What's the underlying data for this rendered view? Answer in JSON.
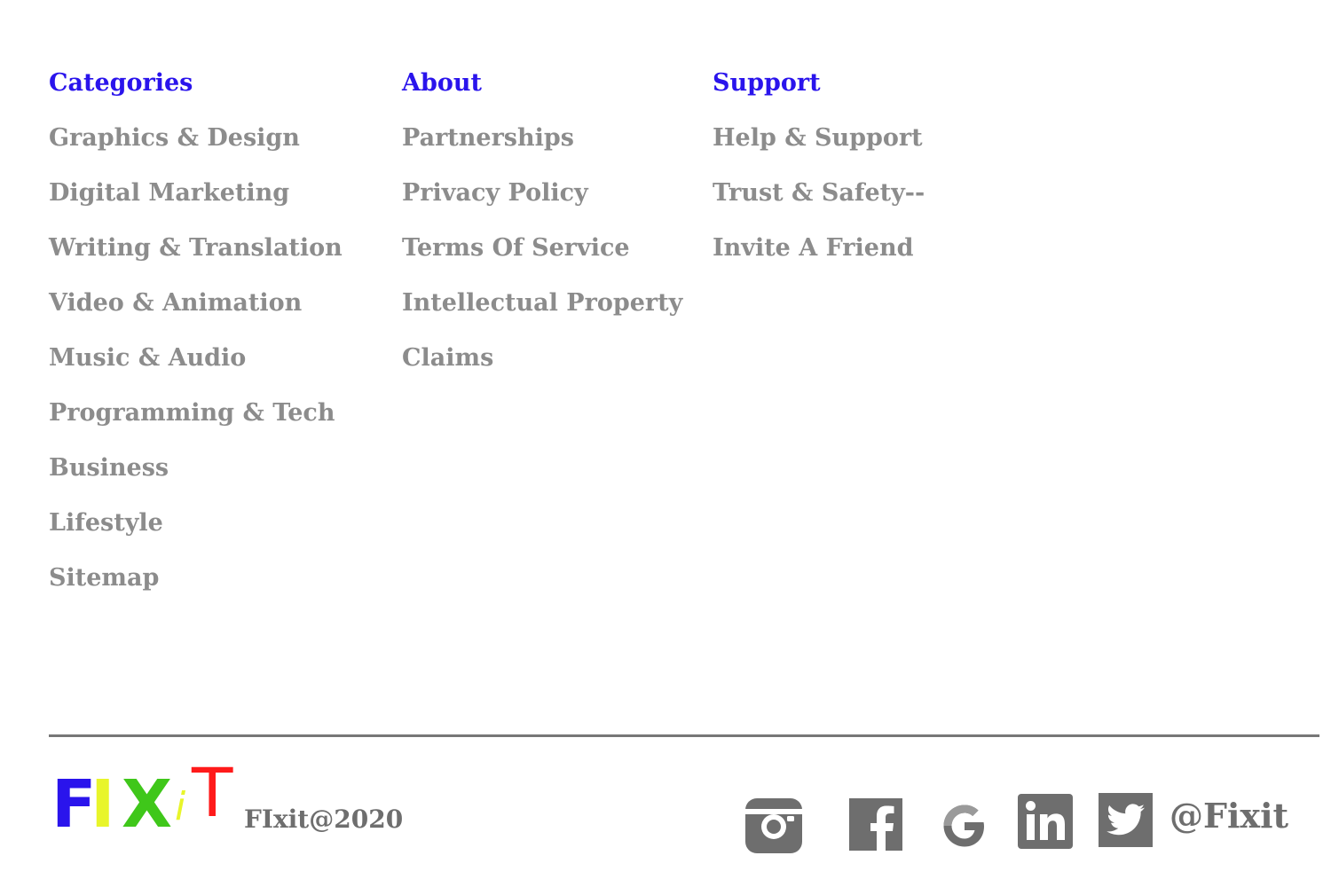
{
  "columns": {
    "categories": {
      "heading": "Categories",
      "items": [
        "Graphics & Design",
        "Digital Marketing",
        "Writing & Translation",
        "Video & Animation",
        "Music & Audio",
        "Programming & Tech",
        "Business",
        "Lifestyle",
        "Sitemap"
      ]
    },
    "about": {
      "heading": "About",
      "items": [
        "Partnerships",
        "Privacy Policy",
        "Terms Of Service",
        "Intellectual Property",
        "Claims"
      ]
    },
    "support": {
      "heading": "Support",
      "items": [
        "Help & Support",
        "Trust & Safety--",
        "Invite A Friend"
      ]
    }
  },
  "bottom_bar": {
    "logo": {
      "letters": [
        {
          "char": "F",
          "color": "#2a14ec"
        },
        {
          "char": "I",
          "color": "#e8f52a"
        },
        {
          "char": "X",
          "color": "#3fc71a"
        },
        {
          "char": "i",
          "color": "#e8f52a"
        },
        {
          "char": "T",
          "color": "#ff1a1a"
        }
      ]
    },
    "copyright": "FIxit@2020",
    "social_icons": [
      "instagram-icon",
      "facebook-icon",
      "google-icon",
      "linkedin-icon",
      "twitter-icon"
    ],
    "handle": "@Fixit"
  },
  "colors": {
    "heading": "#2a14ec",
    "link": "#8c8c8c",
    "divider": "#777777",
    "icon": "#6e6e6e"
  }
}
